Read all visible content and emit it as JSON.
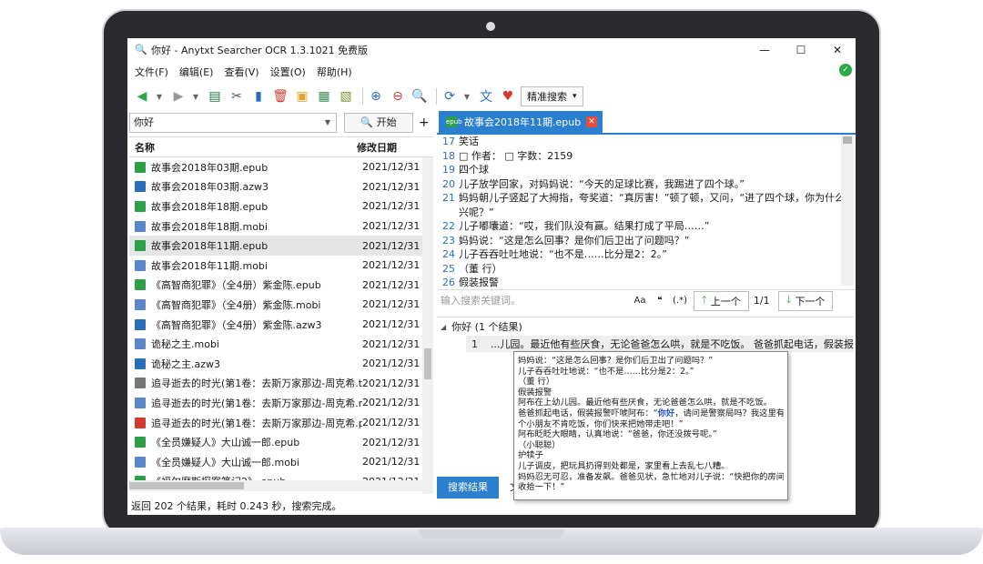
{
  "window": {
    "title": "你好 - Anytxt Searcher OCR 1.3.1021 免费版",
    "minimize": "—",
    "maximize": "☐",
    "close": "✕"
  },
  "menu": [
    "文件(F)",
    "编辑(E)",
    "查看(V)",
    "设置(O)",
    "帮助(H)"
  ],
  "toolbar": {
    "search_mode": "精准搜索",
    "search_mode_arrow": "▾"
  },
  "search": {
    "query": "你好",
    "start_label": "开始",
    "add_tab": "+"
  },
  "file_list": {
    "headers": {
      "name": "名称",
      "date": "修改日期"
    },
    "rows": [
      {
        "name": "故事会2018年03期.epub",
        "date": "2021/12/31 2",
        "type": "epub"
      },
      {
        "name": "故事会2018年03期.azw3",
        "date": "2021/12/31 2",
        "type": "azw3"
      },
      {
        "name": "故事会2018年18期.epub",
        "date": "2021/12/31 2",
        "type": "epub"
      },
      {
        "name": "故事会2018年18期.mobi",
        "date": "2021/12/31 2",
        "type": "mobi"
      },
      {
        "name": "故事会2018年11期.epub",
        "date": "2021/12/31 2",
        "type": "epub",
        "selected": true
      },
      {
        "name": "故事会2018年11期.mobi",
        "date": "2021/12/31 2",
        "type": "mobi"
      },
      {
        "name": "《高智商犯罪》（全4册）紫金陈.epub",
        "date": "2021/12/31 2",
        "type": "epub"
      },
      {
        "name": "《高智商犯罪》（全4册）紫金陈.mobi",
        "date": "2021/12/31 2",
        "type": "mobi"
      },
      {
        "name": "《高智商犯罪》（全4册）紫金陈.azw3",
        "date": "2021/12/31 2",
        "type": "azw3"
      },
      {
        "name": "诡秘之主.mobi",
        "date": "2021/12/31 2",
        "type": "mobi"
      },
      {
        "name": "诡秘之主.azw3",
        "date": "2021/12/31 2",
        "type": "azw3"
      },
      {
        "name": "追寻逝去的时光(第1卷：去斯万家那边-周克希.txt",
        "date": "2021/12/31 2",
        "type": "txt"
      },
      {
        "name": "追寻逝去的时光(第1卷：去斯万家那边-周克希.m...",
        "date": "2021/12/31 2",
        "type": "mobi"
      },
      {
        "name": "追寻逝去的时光(第1卷：去斯万家那边-周克希.pdf",
        "date": "2021/12/31 2",
        "type": "pdf"
      },
      {
        "name": "《全员嫌疑人》大山诚一郎.epub",
        "date": "2021/12/31 2",
        "type": "epub"
      },
      {
        "name": "《全员嫌疑人》大山诚一郎.mobi",
        "date": "2021/12/31 2",
        "type": "mobi"
      },
      {
        "name": "《福尔摩斯探案笔记2》.epub",
        "date": "2021/12/31 2",
        "type": "epub"
      }
    ]
  },
  "status": "返回 202 个结果，耗时 0.243 秒，搜索完成。",
  "doc_tab": {
    "name": "故事会2018年11期.epub",
    "icon_label": "epub",
    "close": "✕"
  },
  "doc_lines": [
    {
      "n": "17",
      "t": "笑话"
    },
    {
      "n": "18",
      "t": "□ 作者：     □ 字数：2159"
    },
    {
      "n": "19",
      "t": "四个球"
    },
    {
      "n": "20",
      "t": "儿子放学回家，对妈妈说：“今天的足球比赛，我踢进了四个球。”"
    },
    {
      "n": "21",
      "t": "妈妈朝儿子竖起了大拇指，夸奖道：“真厉害！”顿了顿，又问，“进了四个球，你为什么还不高"
    },
    {
      "n": "",
      "t": "兴呢？”"
    },
    {
      "n": "22",
      "t": "儿子嘟囔道：“哎，我们队没有赢。结果打成了平局……”"
    },
    {
      "n": "23",
      "t": "妈妈说：“这是怎么回事？是你们后卫出了问题吗？”"
    },
    {
      "n": "24",
      "t": "儿子吞吞吐吐地说：“也不是……比分是2：2。”"
    },
    {
      "n": "25",
      "t": "（董 行）"
    },
    {
      "n": "26",
      "t": "假装报警"
    },
    {
      "n": "27",
      "t": "阿布在上幼儿园。最近他有些厌食，无论爸爸怎么哄，就是不吃饭。"
    }
  ],
  "find": {
    "placeholder": "输入搜索关键词。",
    "opt_case": "Aa",
    "opt_word": "❝",
    "opt_regex": "(.*)",
    "prev": "上一个",
    "count": "1/1",
    "next": "下一个"
  },
  "results": {
    "header": "你好 (1 个结果)",
    "items": [
      {
        "n": "1",
        "t": "...儿园。最近他有些厌食，无论爸爸怎么哄，就是不吃饭。 爸爸抓起电话，假装报警..."
      }
    ]
  },
  "result_tabs": [
    "搜索结果",
    "文"
  ],
  "tooltip": [
    {
      "t": "妈妈说：“这是怎么回事？是你们后卫出了问题吗？”"
    },
    {
      "t": "儿子吞吞吐吐地说：“也不是……比分是2：2。”"
    },
    {
      "t": "（董 行）"
    },
    {
      "t": "假装报警"
    },
    {
      "t": "阿布在上幼儿园。最近他有些厌食，无论爸爸怎么哄，就是不吃饭。"
    },
    {
      "pre": "爸爸抓起电话，假装报警吓唬阿布：“",
      "hl": "你好",
      "post": "，请问是警察局吗？我这里有"
    },
    {
      "t": "个小朋友不肯吃饭，你们快来把她带走吧！”"
    },
    {
      "t": "阿布眨眨大眼睛，认真地说：“爸爸，你还没拨号呢。”"
    },
    {
      "t": "（小聪聪）"
    },
    {
      "t": "护犊子"
    },
    {
      "t": "儿子调皮，把玩具扔得到处都是，家里看上去乱七八糟。"
    },
    {
      "t": "妈妈忍无可忍，准备发飙。爸爸见状，急忙地对儿子说：“快把你的房间"
    },
    {
      "t": "收拾一下！”"
    }
  ]
}
